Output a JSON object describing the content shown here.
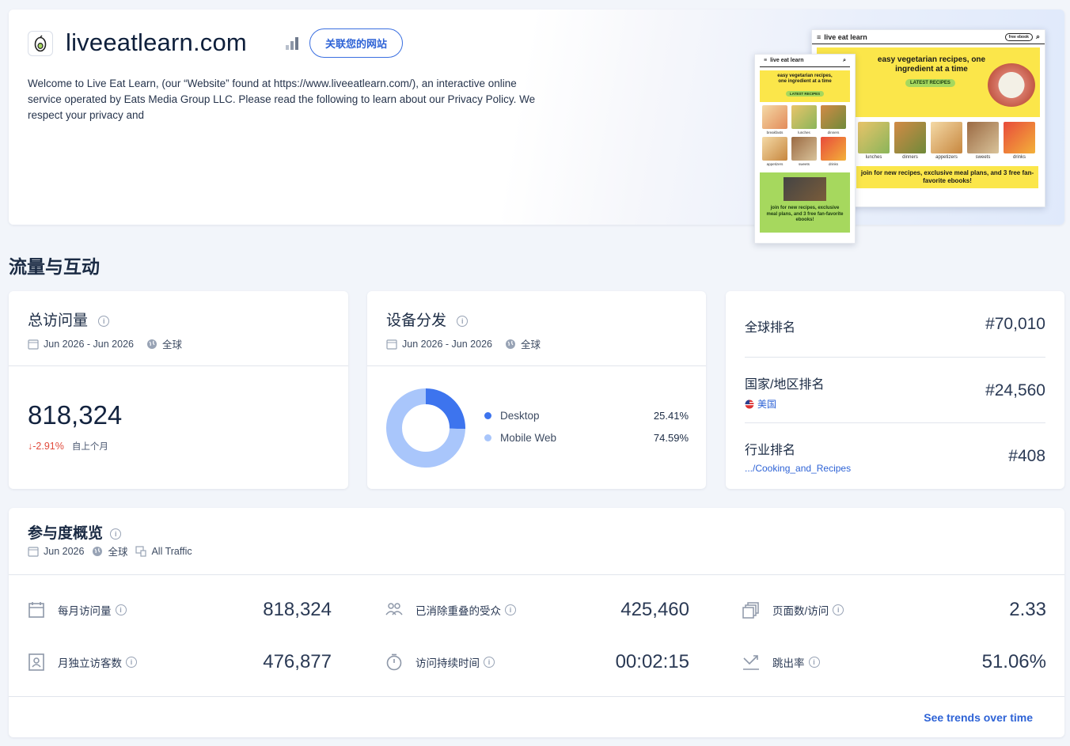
{
  "hero": {
    "site_name": "liveeatlearn.com",
    "link_button": "关联您的网站",
    "description": "Welcome to Live Eat Learn, (our “Website” found at https://www.liveeatlearn.com/), an interactive online service operated by Eats Media Group LLC. Please read the following to learn about our Privacy Policy. We respect your privacy and",
    "desktop_preview": {
      "logo": "live eat learn",
      "ebook_btn": "free ebook",
      "headline": "easy vegetarian recipes, one ingredient at a time",
      "cta": "LATEST RECIPES",
      "categories": [
        "lunches",
        "dinners",
        "appetizers",
        "sweets",
        "drinks"
      ],
      "banner": "join for new recipes, exclusive meal plans, and 3 free fan-favorite ebooks!"
    },
    "mobile_preview": {
      "logo": "live eat learn",
      "headline": "easy vegetarian recipes, one ingredient at a time",
      "cta": "LATEST RECIPES",
      "categories": [
        "breakfasts",
        "lunches",
        "dinners",
        "appetizers",
        "sweets",
        "drinks"
      ],
      "banner": "join for new recipes, exclusive meal plans, and 3 free fan-favorite ebooks!"
    }
  },
  "section_title": "流量与互动",
  "visits_card": {
    "title": "总访问量",
    "date_range": "Jun 2026 - Jun 2026",
    "region": "全球",
    "value": "818,324",
    "delta": "-2.91%",
    "delta_label": "自上个月"
  },
  "device_card": {
    "title": "设备分发",
    "date_range": "Jun 2026 - Jun 2026",
    "region": "全球",
    "legend": [
      {
        "name": "Desktop",
        "pct": "25.41%",
        "color": "#3d74ee"
      },
      {
        "name": "Mobile Web",
        "pct": "74.59%",
        "color": "#a9c6fb"
      }
    ]
  },
  "chart_data": {
    "type": "pie",
    "categories": [
      "Desktop",
      "Mobile Web"
    ],
    "values": [
      25.41,
      74.59
    ],
    "colors": [
      "#3d74ee",
      "#a9c6fb"
    ],
    "title": "",
    "donut": true
  },
  "rank_card": {
    "global_label": "全球排名",
    "global_value": "#70,010",
    "country_label": "国家/地区排名",
    "country_name": "美国",
    "country_value": "#24,560",
    "industry_label": "行业排名",
    "industry_name": ".../Cooking_and_Recipes",
    "industry_value": "#408"
  },
  "engagement": {
    "title": "参与度概览",
    "date": "Jun 2026",
    "region": "全球",
    "traffic": "All Traffic",
    "metrics": [
      {
        "label": "每月访问量",
        "value": "818,324",
        "icon": "calendar-icon"
      },
      {
        "label": "已消除重叠的受众",
        "value": "425,460",
        "icon": "users-icon"
      },
      {
        "label": "页面数/访问",
        "value": "2.33",
        "icon": "pages-icon"
      },
      {
        "label": "月独立访客数",
        "value": "476,877",
        "icon": "visitor-card-icon"
      },
      {
        "label": "访问持续时间",
        "value": "00:02:15",
        "icon": "stopwatch-icon"
      },
      {
        "label": "跳出率",
        "value": "51.06%",
        "icon": "bounce-arrow-icon"
      }
    ],
    "trends_link": "See trends over time"
  }
}
